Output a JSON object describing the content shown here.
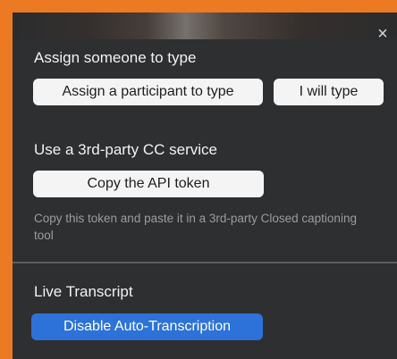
{
  "close_glyph": "×",
  "assign_section": {
    "heading": "Assign someone to type",
    "assign_participant_label": "Assign a participant to type",
    "i_will_type_label": "I will type"
  },
  "third_party_section": {
    "heading": "Use a 3rd-party CC service",
    "copy_token_label": "Copy the API token",
    "description": "Copy this token and paste it in a 3rd-party Closed captioning tool"
  },
  "live_transcript_section": {
    "heading": "Live Transcript",
    "disable_label": "Disable Auto-Transcription"
  },
  "colors": {
    "frame_border": "#ec7a23",
    "panel_bg": "#2e2f31",
    "primary_button": "#2d72d9"
  }
}
